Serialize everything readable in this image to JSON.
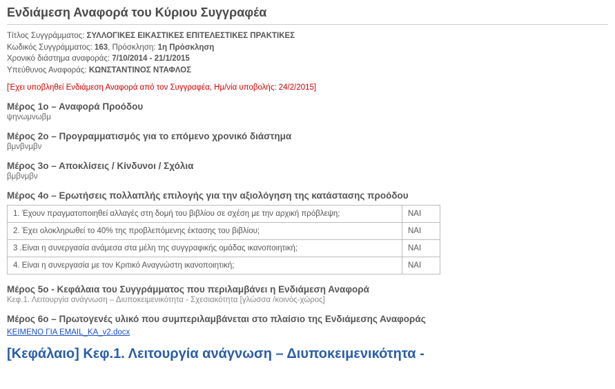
{
  "title": "Ενδιάμεση Αναφορά του Κύριου Συγγραφέα",
  "meta": {
    "book_title_label": "Τίτλος Συγγράμματος:",
    "book_title": "ΣΥΛΛΟΓΙΚΕΣ ΕΙΚΑΣΤΙΚΕΣ ΕΠΙΤΕΛΕΣΤΙΚΕΣ ΠΡΑΚΤΙΚΕΣ",
    "book_code_label": "Κωδικός Συγγράμματος:",
    "book_code": "163",
    "call_label": "Πρόσκληση:",
    "call": "1η Πρόσκληση",
    "period_label": "Χρονικό διάστημα αναφοράς:",
    "period": "7/10/2014 - 21/1/2015",
    "responsible_label": "Υπεύθυνος Αναφοράς:",
    "responsible": "ΚΩΝΣΤΑΝΤΙΝΟΣ ΝΤΑΦΛΟΣ"
  },
  "notice": "[Έχει υποβληθεί Ενδιάμεση Αναφορά από τον Συγγραφέα, Ημ/νία υποβολής: 24/2/2015]",
  "sections": {
    "s1": {
      "heading": "Μέρος 1ο – Αναφορά Προόδου",
      "body": "ψηνωμνωβμ"
    },
    "s2": {
      "heading": "Μέρος 2ο – Προγραμματισμός για το επόμενο χρονικό διάστημα",
      "body": "βμνβνμβν"
    },
    "s3": {
      "heading": "Μέρος 3ο – Αποκλίσεις / Κίνδυνοι / Σχόλια",
      "body": "βμβνμβν"
    },
    "s4": {
      "heading": "Μέρος 4ο – Ερωτήσεις πολλαπλής επιλογής για την αξιολόγηση της κατάστασης προόδου",
      "questions": [
        {
          "q": "1. Έχουν πραγματοποιηθεί αλλαγές στη δομή του βιβλίου σε σχέση με την αρχική πρόβλεψη;",
          "a": "ΝΑΙ"
        },
        {
          "q": "2. Έχει ολοκληρωθεί το 40% της προβλεπόμενης έκτασης του βιβλίου;",
          "a": "ΝΑΙ"
        },
        {
          "q": "3 .Είναι η συνεργασία ανάμεσα στα μέλη της συγγραφικής ομάδας ικανοποιητική;",
          "a": "ΝΑΙ"
        },
        {
          "q": "4. Είναι η συνεργασία με τον Κριτικό Αναγνώστη ικανοποιητική;",
          "a": "ΝΑΙ"
        }
      ]
    },
    "s5": {
      "heading": "Μέρος 5ο - Κεφάλαια του Συγγράμματος που περιλαμβάνει η Ενδιάμεση Αναφορά",
      "sub": "Κεφ.1. Λειτουργία ανάγνωση – Διυποκειμενικότητα - Σχεσιακότητα [γλώσσα /κοινός-χώρος]"
    },
    "s6": {
      "heading": "Μέρος 6ο – Πρωτογενές υλικό που συμπεριλαμβάνεται στο πλαίσιο της Ενδιάμεσης Αναφοράς",
      "file": "ΚΕΙΜΕΝΟ ΓΙΑ EMAIL_KA_v2.docx"
    }
  },
  "chapter_heading": "[Κεφάλαιο] Κεφ.1. Λειτουργία ανάγνωση – Διυποκειμενικότητα -"
}
